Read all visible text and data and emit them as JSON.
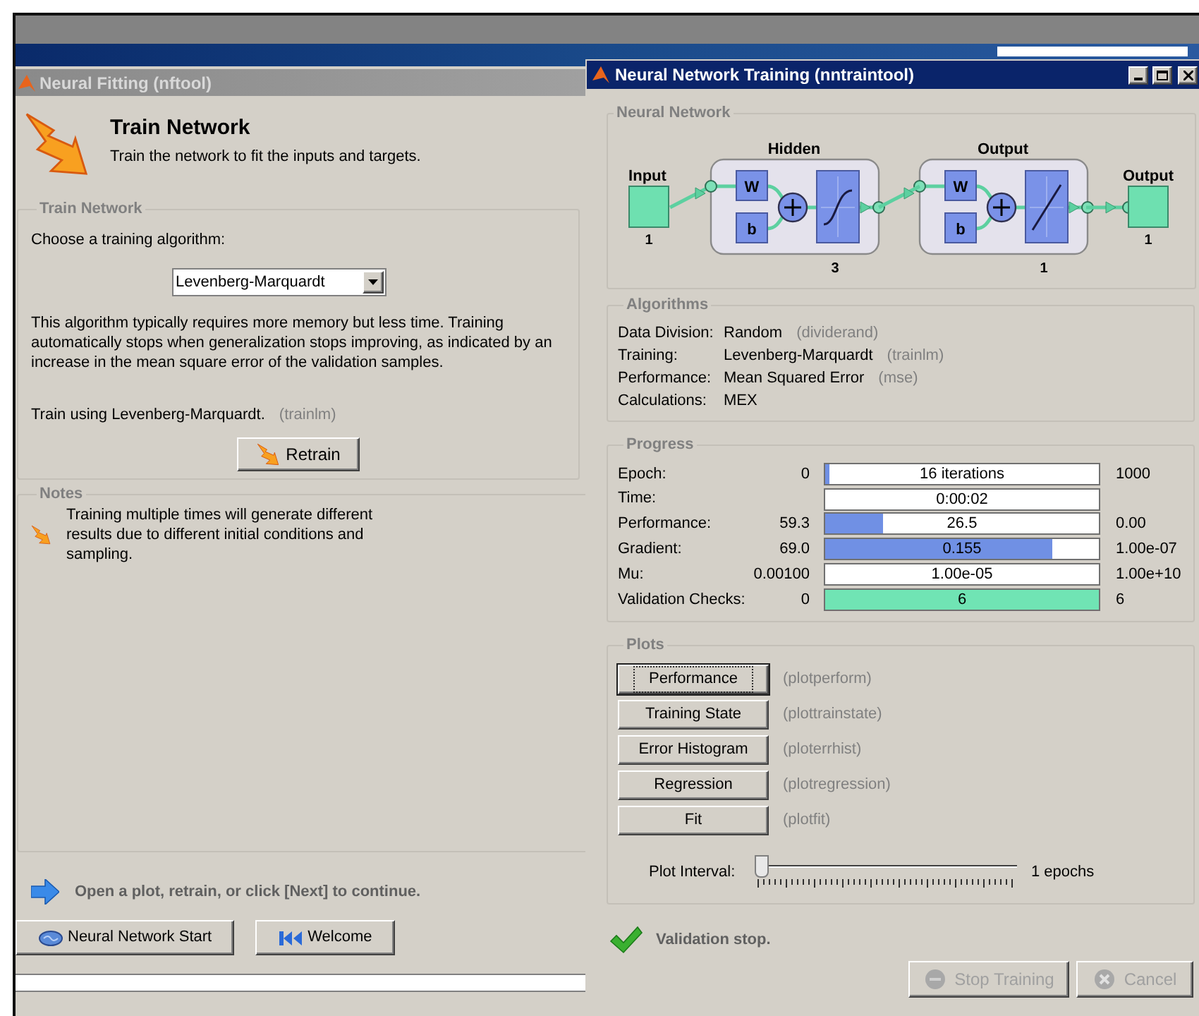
{
  "left_window": {
    "title": "Neural Fitting (nftool)",
    "header": {
      "title": "Train Network",
      "subtitle": "Train the network to fit the inputs and targets."
    },
    "train_group": {
      "title": "Train Network",
      "prompt": "Choose a training algorithm:",
      "algorithm": "Levenberg-Marquardt",
      "description": "This algorithm typically requires more memory but less time. Training automatically stops when generalization stops improving, as indicated by an increase in the mean square error of the validation samples.",
      "train_using": "Train using Levenberg-Marquardt.",
      "train_function": "(trainlm)",
      "retrain_button": "Retrain"
    },
    "notes": {
      "title": "Notes",
      "text": "Training multiple times will generate different results due to different initial conditions and sampling."
    },
    "hint": "Open a plot, retrain, or click [Next] to continue.",
    "buttons": [
      {
        "label": "Neural Network Start",
        "kind": "start"
      },
      {
        "label": "Welcome",
        "kind": "welcome"
      }
    ]
  },
  "right_window": {
    "title": "Neural Network Training (nntraintool)",
    "network": {
      "title": "Neural Network",
      "input": {
        "label": "Input",
        "size": "1"
      },
      "layers": [
        {
          "name": "Hidden",
          "size": "3",
          "weight": "W",
          "bias": "b",
          "kind": "sigmoid"
        },
        {
          "name": "Output",
          "size": "1",
          "weight": "W",
          "bias": "b",
          "kind": "linear"
        }
      ],
      "output": {
        "label": "Output",
        "size": "1"
      }
    },
    "algorithms": {
      "title": "Algorithms",
      "rows": [
        {
          "label": "Data Division:",
          "value": "Random",
          "function": "(dividerand)"
        },
        {
          "label": "Training:",
          "value": "Levenberg-Marquardt",
          "function": "(trainlm)"
        },
        {
          "label": "Performance:",
          "value": "Mean Squared Error",
          "function": "(mse)"
        },
        {
          "label": "Calculations:",
          "value": "MEX"
        }
      ]
    },
    "progress": {
      "title": "Progress",
      "rows": [
        {
          "label": "Epoch:",
          "min": "0",
          "value": "16 iterations",
          "max": "1000",
          "level": 0.016,
          "color": "#7090e4"
        },
        {
          "label": "Time:",
          "value": "0:00:02"
        },
        {
          "label": "Performance:",
          "min": "59.3",
          "value": "26.5",
          "max": "0.00",
          "level": 0.21,
          "color": "#7090e4"
        },
        {
          "label": "Gradient:",
          "min": "69.0",
          "value": "0.155",
          "max": "1.00e-07",
          "level": 0.83,
          "color": "#7090e4"
        },
        {
          "label": "Mu:",
          "min": "0.00100",
          "value": "1.00e-05",
          "max": "1.00e+10"
        },
        {
          "label": "Validation Checks:",
          "min": "0",
          "value": "6",
          "max": "6",
          "level": 1,
          "color": "#70e4b4"
        }
      ]
    },
    "plots": {
      "title": "Plots",
      "items": [
        {
          "label": "Performance",
          "function": "(plotperform)",
          "focused": true
        },
        {
          "label": "Training State",
          "function": "(plottrainstate)",
          "focused": false
        },
        {
          "label": "Error Histogram",
          "function": "(ploterrhist)",
          "focused": false
        },
        {
          "label": "Regression",
          "function": "(plotregression)",
          "focused": false
        },
        {
          "label": "Fit",
          "function": "(plotfit)",
          "focused": false
        }
      ],
      "interval": {
        "label": "Plot Interval:",
        "level": 0,
        "reading": "1 epochs"
      }
    },
    "status": "Validation stop.",
    "buttons": [
      {
        "label": "Stop Training",
        "kind": "stop",
        "disabled": true
      },
      {
        "label": "Cancel",
        "kind": "cancel",
        "disabled": true
      }
    ]
  }
}
